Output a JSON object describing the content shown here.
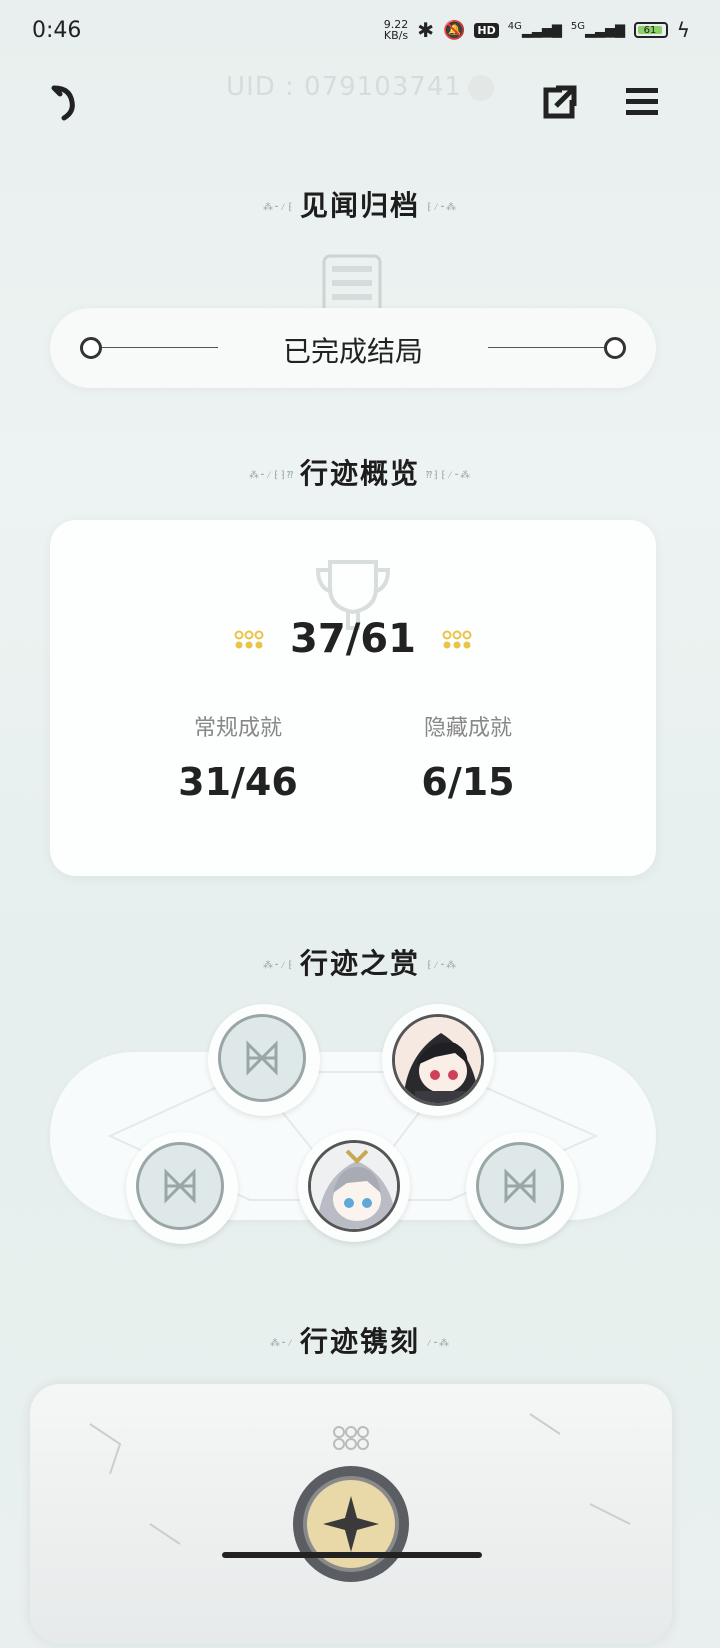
{
  "status_bar": {
    "time": "0:46",
    "net_speed_top": "9.22",
    "net_speed_unit": "KB/s",
    "hd_label": "HD",
    "net1": "4G",
    "net2": "5G",
    "battery": "61"
  },
  "header": {
    "uid": "UID : 079103741"
  },
  "archive": {
    "title": "见闻归档",
    "ending_label": "已完成结局"
  },
  "overview": {
    "title": "行迹概览",
    "total": "37/61",
    "regular_label": "常规成就",
    "regular_value": "31/46",
    "hidden_label": "隐藏成就",
    "hidden_value": "6/15"
  },
  "rewards": {
    "title": "行迹之赏"
  },
  "engrave": {
    "title": "行迹镌刻"
  },
  "colors": {
    "gold": "#e8c548",
    "accent_text": "#222222"
  }
}
